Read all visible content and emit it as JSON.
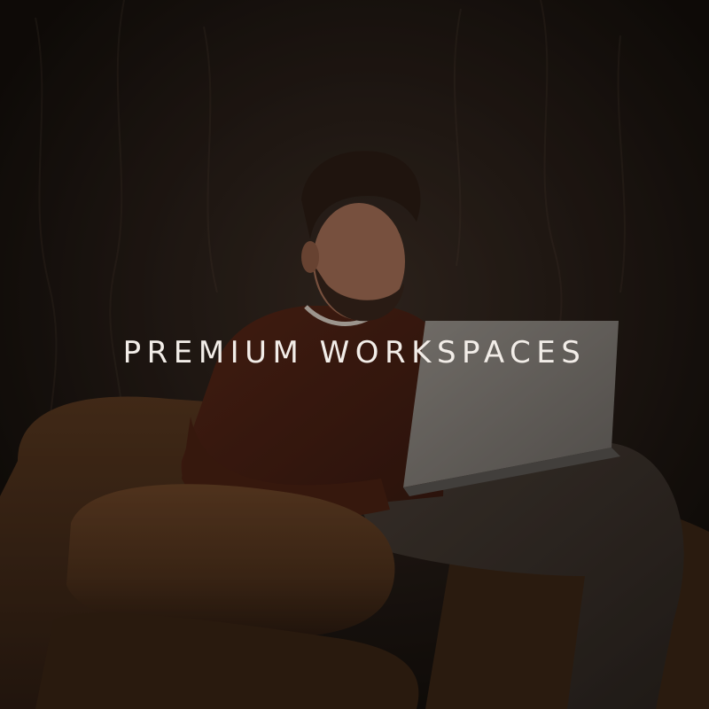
{
  "headline": "PREMIUM WORKSPACES",
  "colors": {
    "text": "#f2ede8",
    "wall": "#2a201a",
    "sofa": "#6a4326",
    "shirt": "#6b2d1c",
    "laptop": "#bdb6ae",
    "trousers": "#4a3e36"
  },
  "scene": {
    "subject": "person-on-sofa-with-laptop"
  }
}
